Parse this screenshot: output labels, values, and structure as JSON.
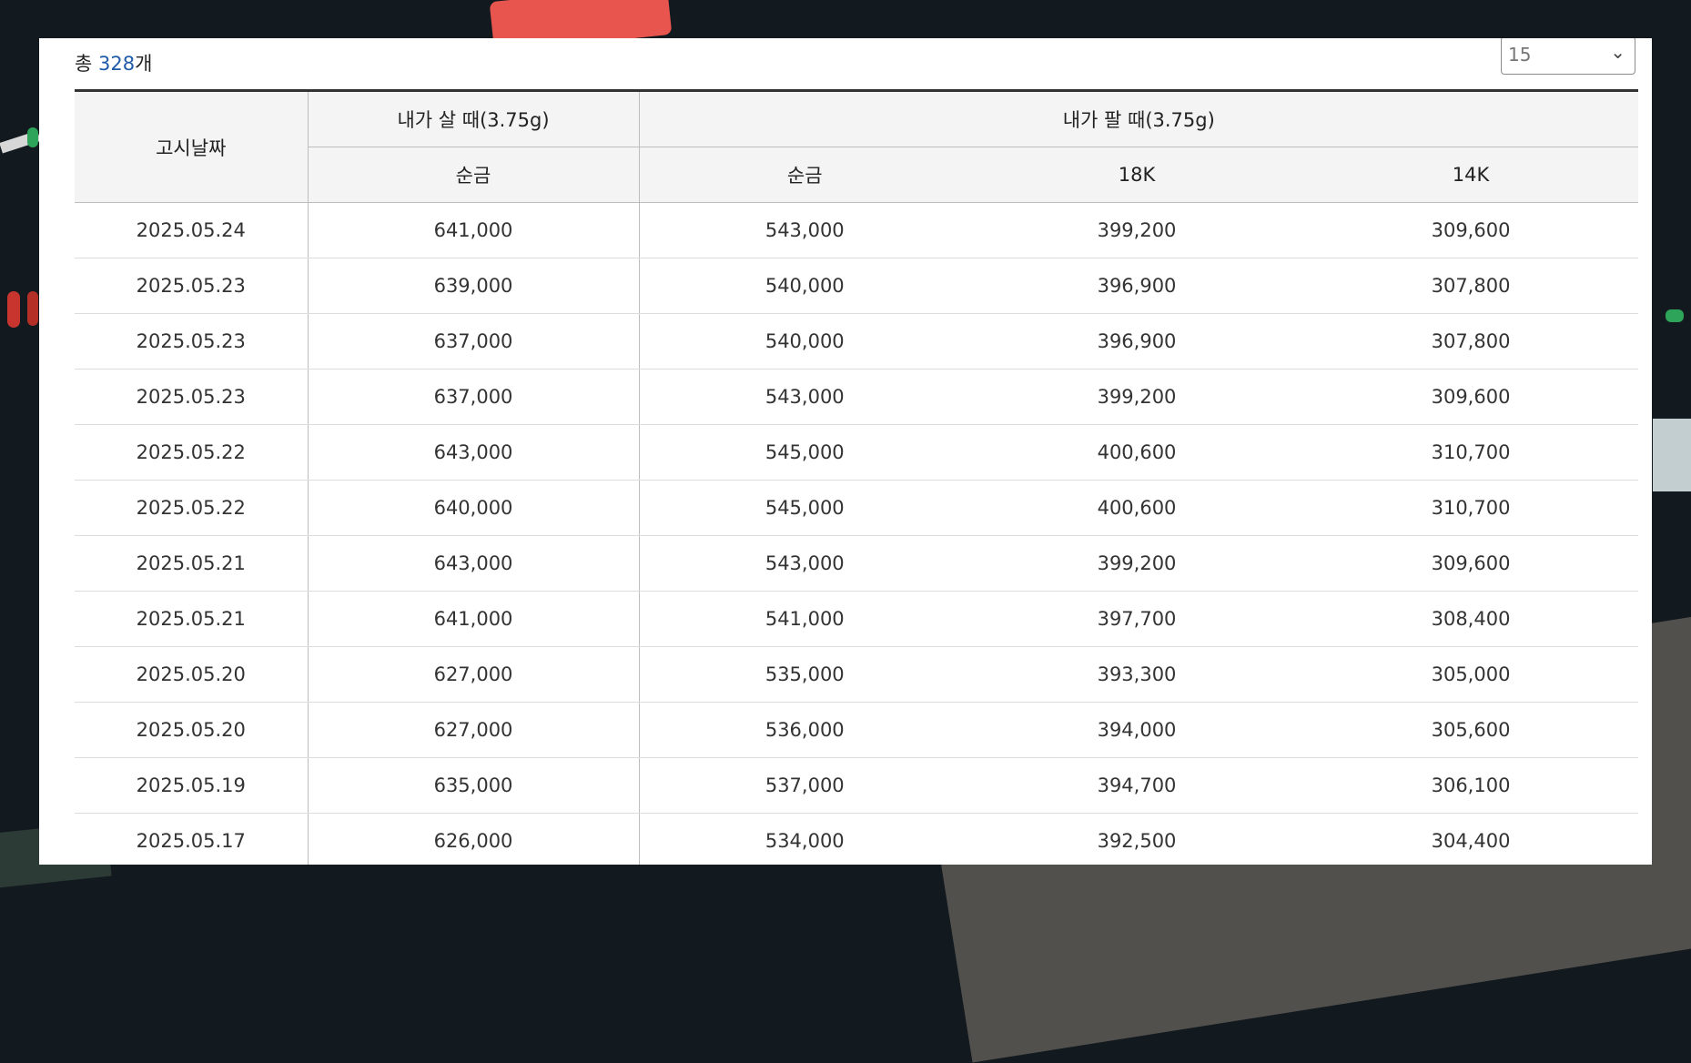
{
  "total": {
    "prefix": "총 ",
    "count": "328",
    "suffix": "개"
  },
  "page_size": {
    "selected": "15"
  },
  "table": {
    "header": {
      "date": "고시날짜",
      "buy_group": "내가 살 때(3.75g)",
      "sell_group": "내가 팔 때(3.75g)",
      "buy_pure": "순금",
      "sell_pure": "순금",
      "sell_18k": "18K",
      "sell_14k": "14K"
    },
    "rows": [
      [
        "2025.05.24",
        "641,000",
        "543,000",
        "399,200",
        "309,600"
      ],
      [
        "2025.05.23",
        "639,000",
        "540,000",
        "396,900",
        "307,800"
      ],
      [
        "2025.05.23",
        "637,000",
        "540,000",
        "396,900",
        "307,800"
      ],
      [
        "2025.05.23",
        "637,000",
        "543,000",
        "399,200",
        "309,600"
      ],
      [
        "2025.05.22",
        "643,000",
        "545,000",
        "400,600",
        "310,700"
      ],
      [
        "2025.05.22",
        "640,000",
        "545,000",
        "400,600",
        "310,700"
      ],
      [
        "2025.05.21",
        "643,000",
        "543,000",
        "399,200",
        "309,600"
      ],
      [
        "2025.05.21",
        "641,000",
        "541,000",
        "397,700",
        "308,400"
      ],
      [
        "2025.05.20",
        "627,000",
        "535,000",
        "393,300",
        "305,000"
      ],
      [
        "2025.05.20",
        "627,000",
        "536,000",
        "394,000",
        "305,600"
      ],
      [
        "2025.05.19",
        "635,000",
        "537,000",
        "394,700",
        "306,100"
      ],
      [
        "2025.05.17",
        "626,000",
        "534,000",
        "392,500",
        "304,400"
      ]
    ]
  }
}
